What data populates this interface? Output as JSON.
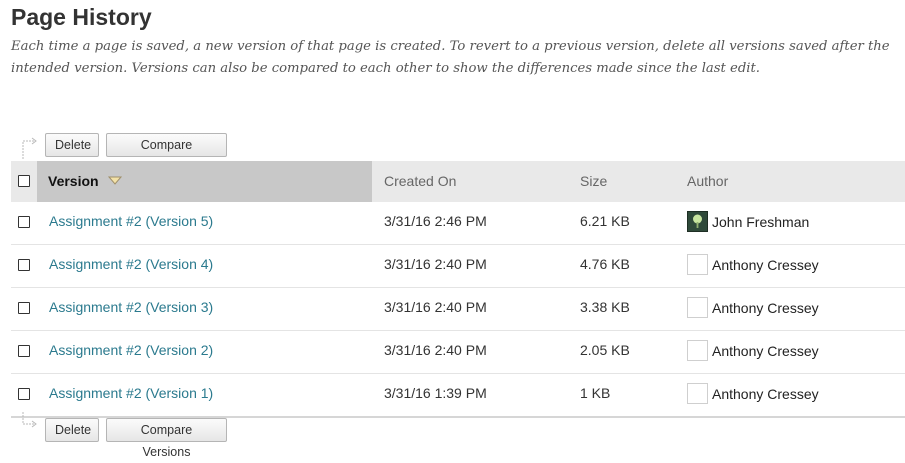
{
  "page": {
    "title": "Page History",
    "description": "Each time a page is saved, a new version of that page is created. To revert to a previous version, delete all versions saved after the intended version. Versions can also be compared to each other to show the differences made since the last edit."
  },
  "actions": {
    "delete_label": "Delete",
    "compare_label": "Compare Versions"
  },
  "table": {
    "columns": {
      "version": "Version",
      "created": "Created On",
      "size": "Size",
      "author": "Author"
    },
    "sort": {
      "column": "version",
      "direction": "descending",
      "icon": "triangle-down-icon"
    },
    "rows": [
      {
        "version": "Assignment #2 (Version 5)",
        "created": "3/31/16 2:46 PM",
        "size": "6.21 KB",
        "author": "John Freshman",
        "avatar": "photo"
      },
      {
        "version": "Assignment #2 (Version 4)",
        "created": "3/31/16 2:40 PM",
        "size": "4.76 KB",
        "author": "Anthony Cressey",
        "avatar": "blank"
      },
      {
        "version": "Assignment #2 (Version 3)",
        "created": "3/31/16 2:40 PM",
        "size": "3.38 KB",
        "author": "Anthony Cressey",
        "avatar": "blank"
      },
      {
        "version": "Assignment #2 (Version 2)",
        "created": "3/31/16 2:40 PM",
        "size": "2.05 KB",
        "author": "Anthony Cressey",
        "avatar": "blank"
      },
      {
        "version": "Assignment #2 (Version 1)",
        "created": "3/31/16 1:39 PM",
        "size": "1 KB",
        "author": "Anthony Cressey",
        "avatar": "blank"
      }
    ]
  },
  "colors": {
    "link": "#2b7a8e",
    "header_bg": "#e9e9e9",
    "sorted_header_bg": "#c8c8c8",
    "sort_icon": "#f3e2a8"
  }
}
